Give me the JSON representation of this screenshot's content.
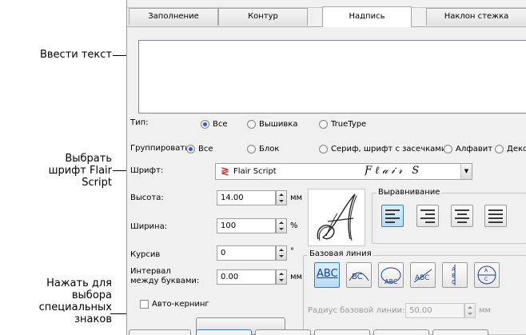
{
  "callouts": {
    "enter_text": "Ввести текст",
    "choose_font_l1": "Выбрать",
    "choose_font_l2": "шрифт Flair",
    "choose_font_l3": "Script",
    "special_l1": "Нажать для",
    "special_l2": "выбора",
    "special_l3": "специальных",
    "special_l4": "знаков"
  },
  "tabs": [
    {
      "label": "Заполнение"
    },
    {
      "label": "Контур"
    },
    {
      "label": "Надпись"
    },
    {
      "label": "Наклон стежка"
    }
  ],
  "text_input": {
    "value": ""
  },
  "type_row": {
    "label": "Тип:",
    "options": [
      "Все",
      "Вышивка",
      "TrueType"
    ],
    "selected": "Все"
  },
  "group_row": {
    "label": "Группировать:",
    "options": [
      "Все",
      "Блок",
      "Сериф, шрифт с засечками",
      "Алфавит",
      "Деко"
    ],
    "selected": "Все"
  },
  "font_row": {
    "label": "Шрифт:",
    "value": "Flair Script",
    "preview": "Ƒℓ𝒶𝒾𝓇 S"
  },
  "height": {
    "label": "Высота:",
    "value": "14.00",
    "unit": "мм"
  },
  "width": {
    "label": "Ширина:",
    "value": "100",
    "unit": "%"
  },
  "italic": {
    "label": "Курсив",
    "value": "0",
    "unit": "°"
  },
  "spacing": {
    "label_l1": "Интервал",
    "label_l2": "между буквами:",
    "value": "0.00",
    "unit": "мм"
  },
  "autokern": {
    "label": "Авто-кернинг",
    "checked": false
  },
  "alignment": {
    "caption": "Выравнивание",
    "selected": "left"
  },
  "baseline": {
    "caption": "Базовая линия",
    "sample": "ABC",
    "radius_label": "Радиус базовой линии:",
    "radius_value": "50.00",
    "radius_unit": "мм"
  },
  "colors": {
    "accent": "#2a5bd7",
    "font_icon_red": "#d2232a"
  }
}
